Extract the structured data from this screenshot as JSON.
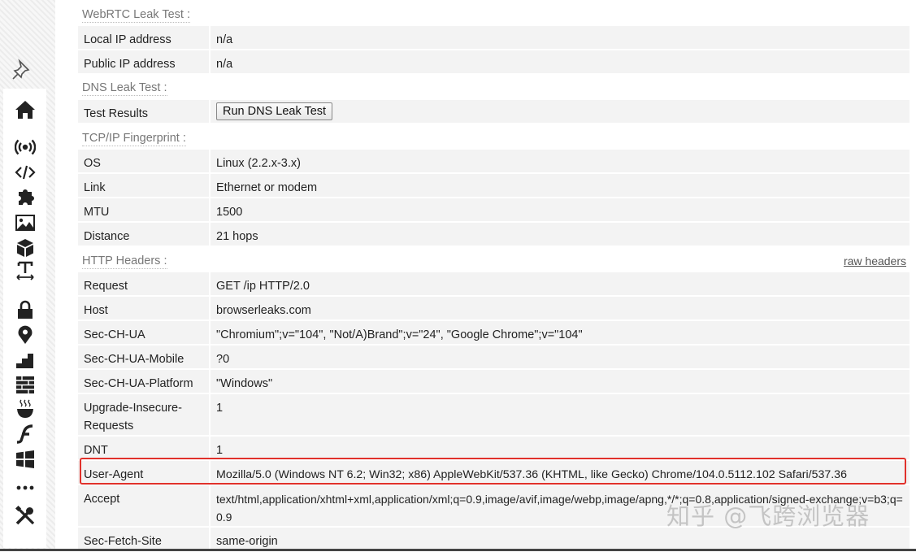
{
  "sections": {
    "webrtc": {
      "title": "WebRTC Leak Test :",
      "rows": [
        {
          "key": "Local IP address",
          "value": "n/a"
        },
        {
          "key": "Public IP address",
          "value": "n/a"
        }
      ]
    },
    "dns": {
      "title": "DNS Leak Test :",
      "row_key": "Test Results",
      "button_label": "Run DNS Leak Test"
    },
    "tcpip": {
      "title": "TCP/IP Fingerprint :",
      "rows": [
        {
          "key": "OS",
          "value": "Linux (2.2.x-3.x)"
        },
        {
          "key": "Link",
          "value": "Ethernet or modem"
        },
        {
          "key": "MTU",
          "value": "1500"
        },
        {
          "key": "Distance",
          "value": "21 hops"
        }
      ]
    },
    "http": {
      "title": "HTTP Headers :",
      "raw_link": "raw headers",
      "rows": [
        {
          "key": "Request",
          "value": "GET /ip HTTP/2.0"
        },
        {
          "key": "Host",
          "value": "browserleaks.com"
        },
        {
          "key": "Sec-CH-UA",
          "value": "\"Chromium\";v=\"104\", \"Not/A)Brand\";v=\"24\", \"Google Chrome\";v=\"104\""
        },
        {
          "key": "Sec-CH-UA-Mobile",
          "value": "?0"
        },
        {
          "key": "Sec-CH-UA-Platform",
          "value": "\"Windows\""
        },
        {
          "key": "Upgrade-Insecure-Requests",
          "value": "1"
        },
        {
          "key": "DNT",
          "value": "1"
        },
        {
          "key": "User-Agent",
          "value": "Mozilla/5.0 (Windows NT 6.2; Win32; x86) AppleWebKit/537.36 (KHTML, like Gecko) Chrome/104.0.5112.102 Safari/537.36"
        },
        {
          "key": "Accept",
          "value": "text/html,application/xhtml+xml,application/xml;q=0.9,image/avif,image/webp,image/apng,*/*;q=0.8,application/signed-exchange;v=b3;q=0.9"
        },
        {
          "key": "Sec-Fetch-Site",
          "value": "same-origin"
        }
      ]
    }
  },
  "highlight_color": "#e0312b",
  "watermark": "知乎 @飞跨浏览器",
  "sidebar_icons": [
    "pin-icon",
    "home-icon",
    "broadcast-icon",
    "code-icon",
    "puzzle-icon",
    "image-icon",
    "cube-icon",
    "text-width-icon",
    "lock-icon",
    "map-pin-icon",
    "stairs-icon",
    "bricks-icon",
    "coffee-icon",
    "flash-icon",
    "windows-icon",
    "more-icon",
    "tools-icon"
  ]
}
